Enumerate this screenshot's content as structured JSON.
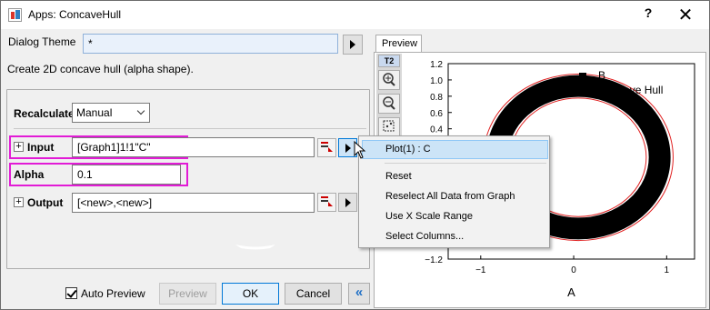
{
  "window": {
    "title": "Apps: ConcaveHull",
    "help_label": "?",
    "close_label": "✕"
  },
  "dialog_theme": {
    "label": "Dialog Theme",
    "value": "*"
  },
  "description": "Create 2D concave hull (alpha shape).",
  "recalculate": {
    "label": "Recalculate",
    "value": "Manual"
  },
  "input": {
    "label": "Input",
    "value": "[Graph1]1!1\"C\""
  },
  "alpha": {
    "label": "Alpha",
    "value": "0.1"
  },
  "output": {
    "label": "Output",
    "value": "[<new>,<new>]"
  },
  "buttons": {
    "auto_preview": "Auto Preview",
    "preview": "Preview",
    "ok": "OK",
    "cancel": "Cancel",
    "collapse": "«"
  },
  "auto_preview_checked": true,
  "preview_tab": "Preview",
  "toolbar": {
    "t2": "T2"
  },
  "menu": {
    "items": [
      "Plot(1) : C",
      "Reset",
      "Reselect All Data from Graph",
      "Use X Scale Range",
      "Select Columns..."
    ],
    "highlighted_index": 0
  },
  "chart_data": {
    "type": "scatter",
    "x_ticks": [
      "−1",
      "0",
      "1"
    ],
    "y_ticks": [
      "1.2",
      "1.0",
      "0.8",
      "0.6",
      "0.4",
      "0.2",
      "0.0",
      "−0.2",
      "−0.4",
      "−0.6",
      "−0.8",
      "−1.0",
      "−1.2"
    ],
    "xlabel": "A",
    "xlim": [
      -1.35,
      1.3
    ],
    "ylim": [
      -1.2,
      1.2
    ],
    "legend": [
      "B",
      "Concave Hull"
    ],
    "legend_placement": "top-right",
    "series": [
      {
        "name": "B",
        "shape": "ring of points",
        "center": [
          0.05,
          0.05
        ],
        "outer_radius": 1.0,
        "inner_radius": 0.75,
        "color": "#000000"
      },
      {
        "name": "Concave Hull",
        "color": "#e02020"
      }
    ]
  }
}
